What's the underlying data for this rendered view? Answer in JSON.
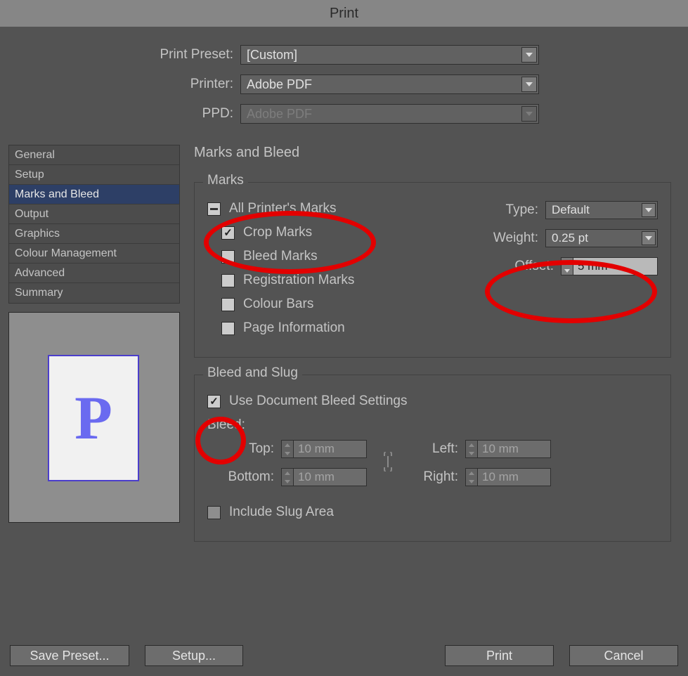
{
  "title": "Print",
  "top": {
    "preset_label": "Print Preset:",
    "preset_value": "[Custom]",
    "printer_label": "Printer:",
    "printer_value": "Adobe PDF",
    "ppd_label": "PPD:",
    "ppd_value": "Adobe PDF"
  },
  "nav": {
    "items": [
      "General",
      "Setup",
      "Marks and Bleed",
      "Output",
      "Graphics",
      "Colour Management",
      "Advanced",
      "Summary"
    ],
    "selected_index": 2
  },
  "panel_title": "Marks and Bleed",
  "marks": {
    "legend": "Marks",
    "all_label": "All Printer's Marks",
    "crop_label": "Crop Marks",
    "bleed_label": "Bleed Marks",
    "reg_label": "Registration Marks",
    "colour_label": "Colour Bars",
    "page_label": "Page Information",
    "all_state": "mixed",
    "crop_checked": true,
    "others_checked": false,
    "type_label": "Type:",
    "type_value": "Default",
    "weight_label": "Weight:",
    "weight_value": "0.25 pt",
    "offset_label": "Offset:",
    "offset_value": "5 mm"
  },
  "bleed": {
    "legend": "Bleed and Slug",
    "use_doc_label": "Use Document Bleed Settings",
    "use_doc_checked": true,
    "bleed_label": "Bleed:",
    "top_label": "Top:",
    "bottom_label": "Bottom:",
    "left_label": "Left:",
    "right_label": "Right:",
    "value": "10 mm",
    "include_label": "Include Slug Area",
    "include_checked": false
  },
  "preview_letter": "P",
  "buttons": {
    "save_preset": "Save Preset...",
    "setup": "Setup...",
    "print": "Print",
    "cancel": "Cancel"
  }
}
